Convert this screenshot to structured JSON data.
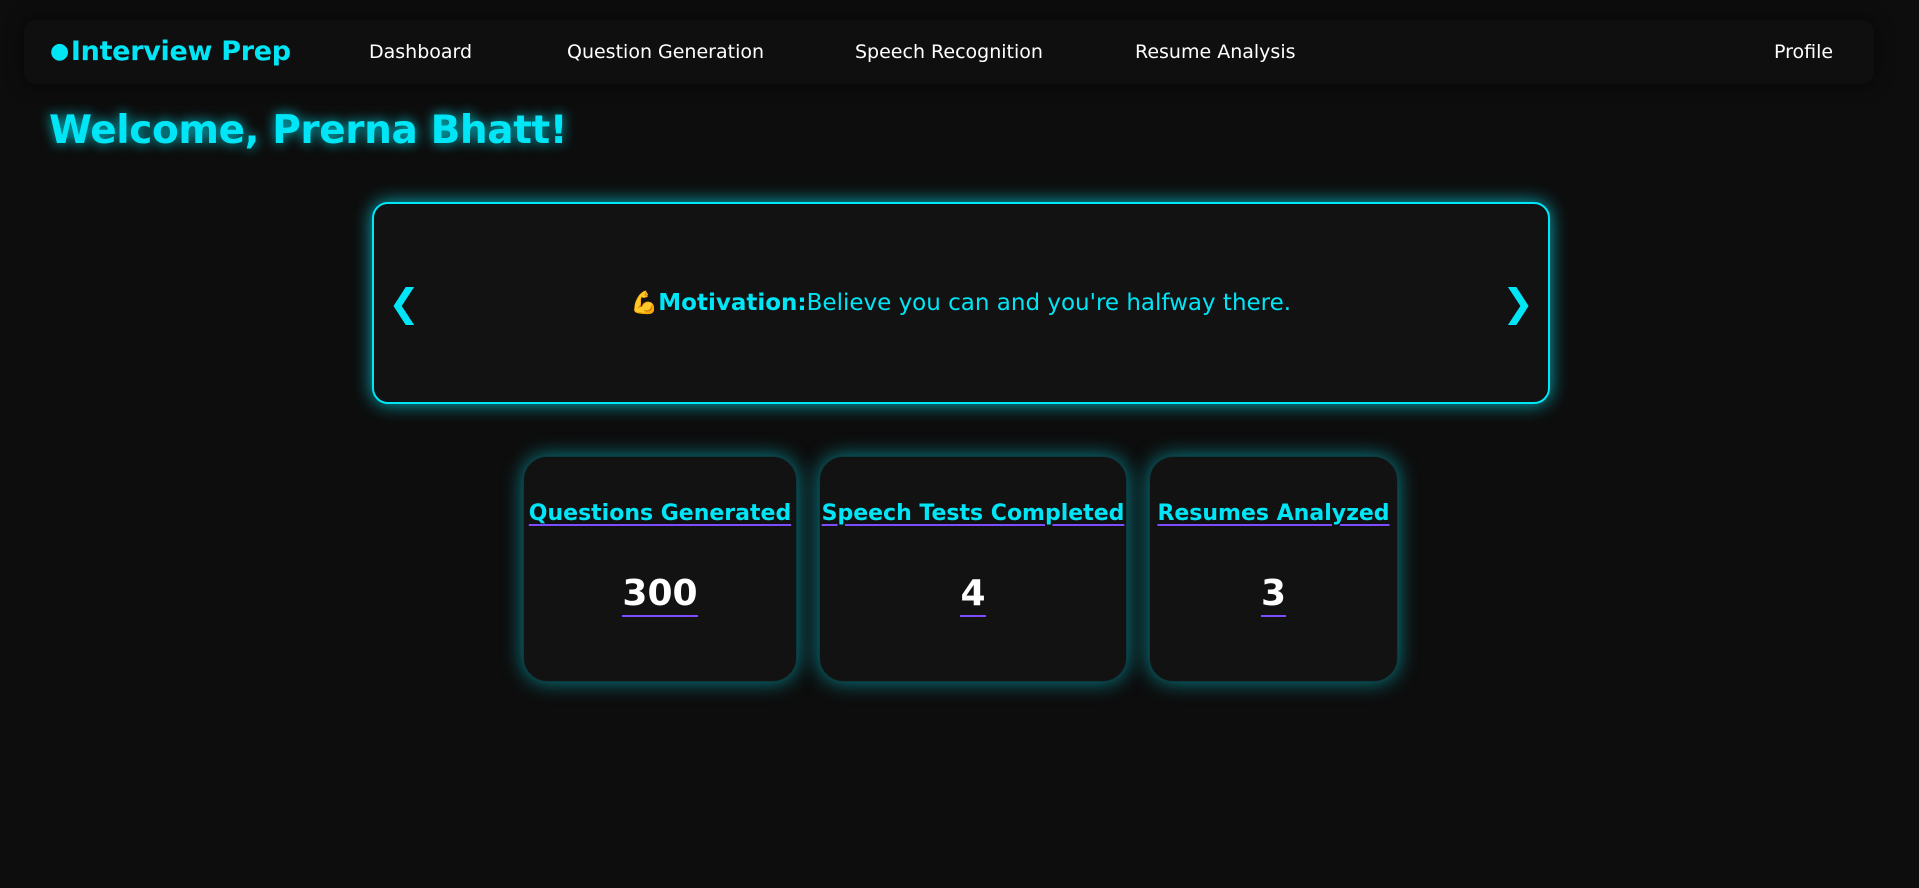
{
  "nav": {
    "brand_dot": "●",
    "brand": "Interview Prep",
    "links": [
      {
        "label": "Dashboard"
      },
      {
        "label": "Question Generation"
      },
      {
        "label": "Speech Recognition"
      },
      {
        "label": "Resume Analysis"
      }
    ],
    "profile": "Profile"
  },
  "welcome": "Welcome, Prerna Bhatt!",
  "carousel": {
    "prev_icon": "❮",
    "next_icon": "❯",
    "emoji": "💪",
    "label": "Motivation:",
    "text": "Believe you can and you're halfway there."
  },
  "stats": [
    {
      "title": "Questions Generated",
      "value": "300"
    },
    {
      "title": "Speech Tests Completed",
      "value": "4"
    },
    {
      "title": "Resumes Analyzed",
      "value": "3"
    }
  ],
  "colors": {
    "accent": "#00e6f6",
    "background": "#0d0d0d",
    "card": "#121212",
    "underline": "#7b4dff"
  }
}
